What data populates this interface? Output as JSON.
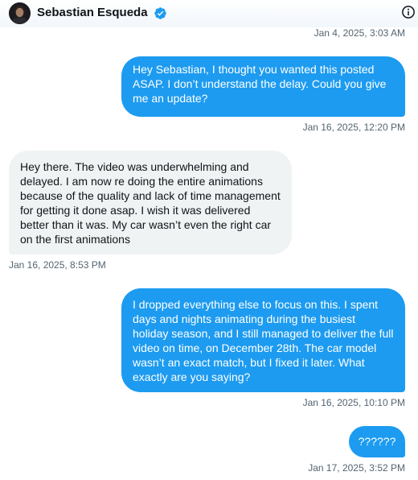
{
  "header": {
    "name": "Sebastian Esqueda",
    "avatar_icon": "user-avatar",
    "verified_icon": "verified-badge-icon",
    "info_icon": "info-icon",
    "accent": "#1d9bf0"
  },
  "conversation": {
    "top_timestamp": "Jan 4, 2025, 3:03 AM",
    "messages": [
      {
        "direction": "outgoing",
        "text": "Hey Sebastian, I thought you wanted this posted\nASAP. I don’t understand the delay.  Could you give\nme an update?",
        "timestamp": "Jan 16, 2025, 12:20 PM"
      },
      {
        "direction": "incoming",
        "text": "Hey there. The video was underwhelming and\ndelayed. I am now re doing the entire animations\nbecause of the quality and lack of time management\nfor getting it done asap. I wish it was delivered\nbetter than it was. My car wasn’t even the right car\non the first animations",
        "timestamp": "Jan 16, 2025, 8:53 PM"
      },
      {
        "direction": "outgoing",
        "text": "I dropped everything else to focus on this. I spent\ndays and nights animating during the busiest\nholiday season, and I still managed to deliver the full\nvideo on time, on December 28th. The car model\nwasn’t an exact match, but I fixed it later. What\nexactly are you saying?",
        "timestamp": "Jan 16, 2025, 10:10 PM"
      },
      {
        "direction": "outgoing",
        "text": "??????",
        "timestamp": "Jan 17, 2025, 3:52 PM"
      }
    ]
  },
  "colors": {
    "outgoing_bubble": "#1d9bf0",
    "incoming_bubble": "#eff3f4",
    "timestamp_text": "#536471"
  }
}
